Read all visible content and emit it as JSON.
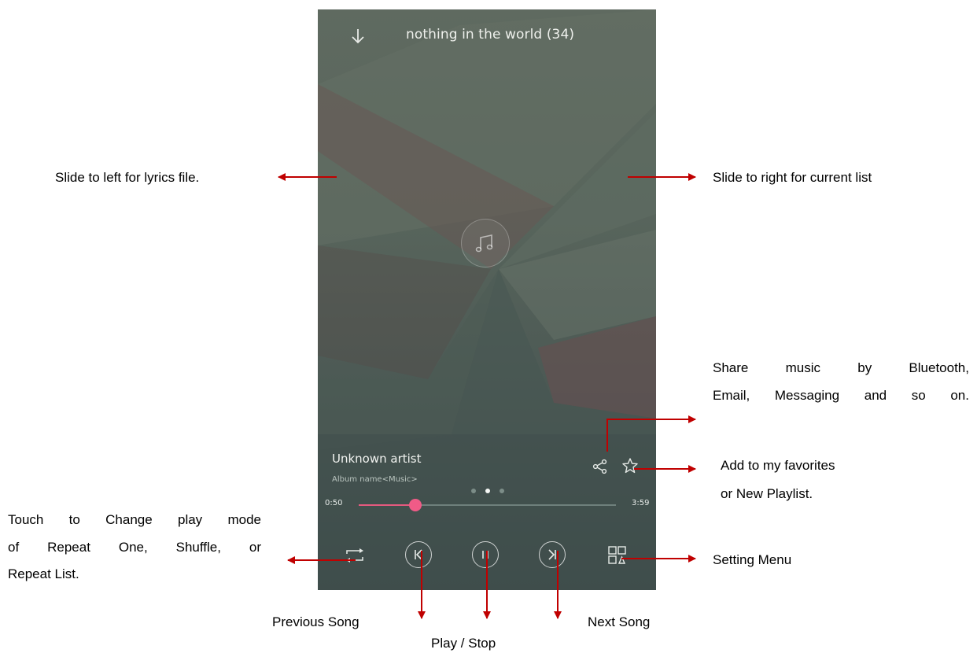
{
  "player": {
    "title": "nothing in the world (34)",
    "artist": "Unknown artist",
    "album": "Album name<Music>",
    "elapsed": "0:50",
    "total": "3:59",
    "progress_fraction": 0.22,
    "page_dots": {
      "count": 3,
      "active_index": 1
    },
    "accent_color": "#f05b87",
    "icons": {
      "collapse": "arrow-down-icon",
      "art": "music-note-icon",
      "share": "share-icon",
      "favorite": "star-icon",
      "repeat": "repeat-icon",
      "previous": "previous-icon",
      "pause": "pause-icon",
      "next": "next-icon",
      "menu": "grid-menu-icon"
    }
  },
  "annotations": {
    "lyrics": "Slide to left for lyrics file.",
    "current_list": "Slide to right for current list",
    "share_line1": "Share music by Bluetooth,",
    "share_line2": "Email, Messaging and so on.",
    "favorites_line1": "Add to my favorites",
    "favorites_line2": "or New Playlist.",
    "play_mode_line1": "Touch to Change play mode",
    "play_mode_line2": "of Repeat One, Shuffle, or",
    "play_mode_line3": "Repeat List.",
    "setting_menu": "Setting Menu",
    "previous_song": "Previous Song",
    "play_stop": "Play / Stop",
    "next_song": "Next Song",
    "arrow_color": "#c00000"
  }
}
